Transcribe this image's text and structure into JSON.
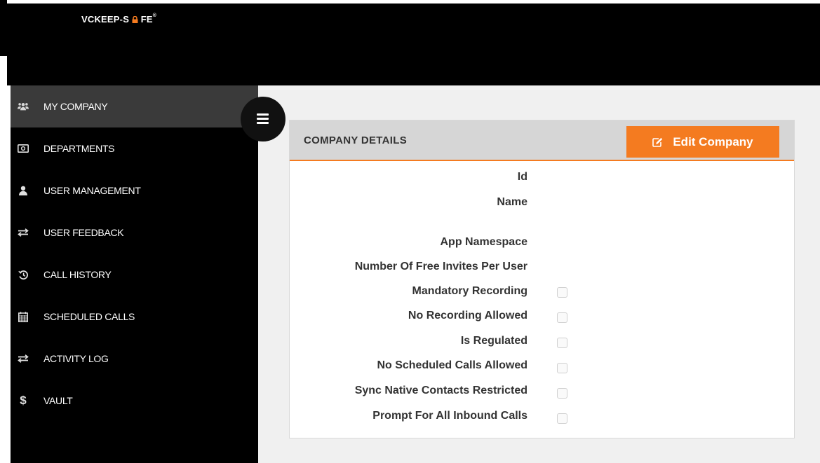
{
  "header": {
    "logo_prefix": "VCKEEP-S",
    "logo_lock": "Δ",
    "logo_suffix": "FE",
    "logo_mark": "®"
  },
  "sidebar": {
    "items": [
      {
        "label": "MY COMPANY",
        "icon": "users-icon",
        "active": true
      },
      {
        "label": "DEPARTMENTS",
        "icon": "id-card-icon"
      },
      {
        "label": "USER MANAGEMENT",
        "icon": "user-icon"
      },
      {
        "label": "USER FEEDBACK",
        "icon": "exchange-icon"
      },
      {
        "label": "CALL HISTORY",
        "icon": "history-icon"
      },
      {
        "label": "SCHEDULED CALLS",
        "icon": "calendar-icon"
      },
      {
        "label": "ACTIVITY LOG",
        "icon": "exchange-icon"
      },
      {
        "label": "VAULT",
        "icon": "dollar-icon"
      }
    ]
  },
  "panel": {
    "title": "COMPANY DETAILS",
    "edit_button": "Edit Company",
    "fields": [
      {
        "label": "Id"
      },
      {
        "label": "Name"
      },
      {
        "label": "App Namespace"
      },
      {
        "label": "Number Of Free Invites Per User"
      },
      {
        "label": "Mandatory Recording",
        "checked": false
      },
      {
        "label": "No Recording Allowed",
        "checked": false
      },
      {
        "label": "Is Regulated",
        "checked": false
      },
      {
        "label": "No Scheduled Calls Allowed",
        "checked": false
      },
      {
        "label": "Sync Native Contacts Restricted",
        "checked": false
      },
      {
        "label": "Prompt For All Inbound Calls",
        "checked": false
      }
    ]
  },
  "colors": {
    "accent": "#f47b20",
    "sidebar_bg": "#000000",
    "active_item_bg": "#3a3a3a",
    "content_bg": "#f0f0f0"
  }
}
